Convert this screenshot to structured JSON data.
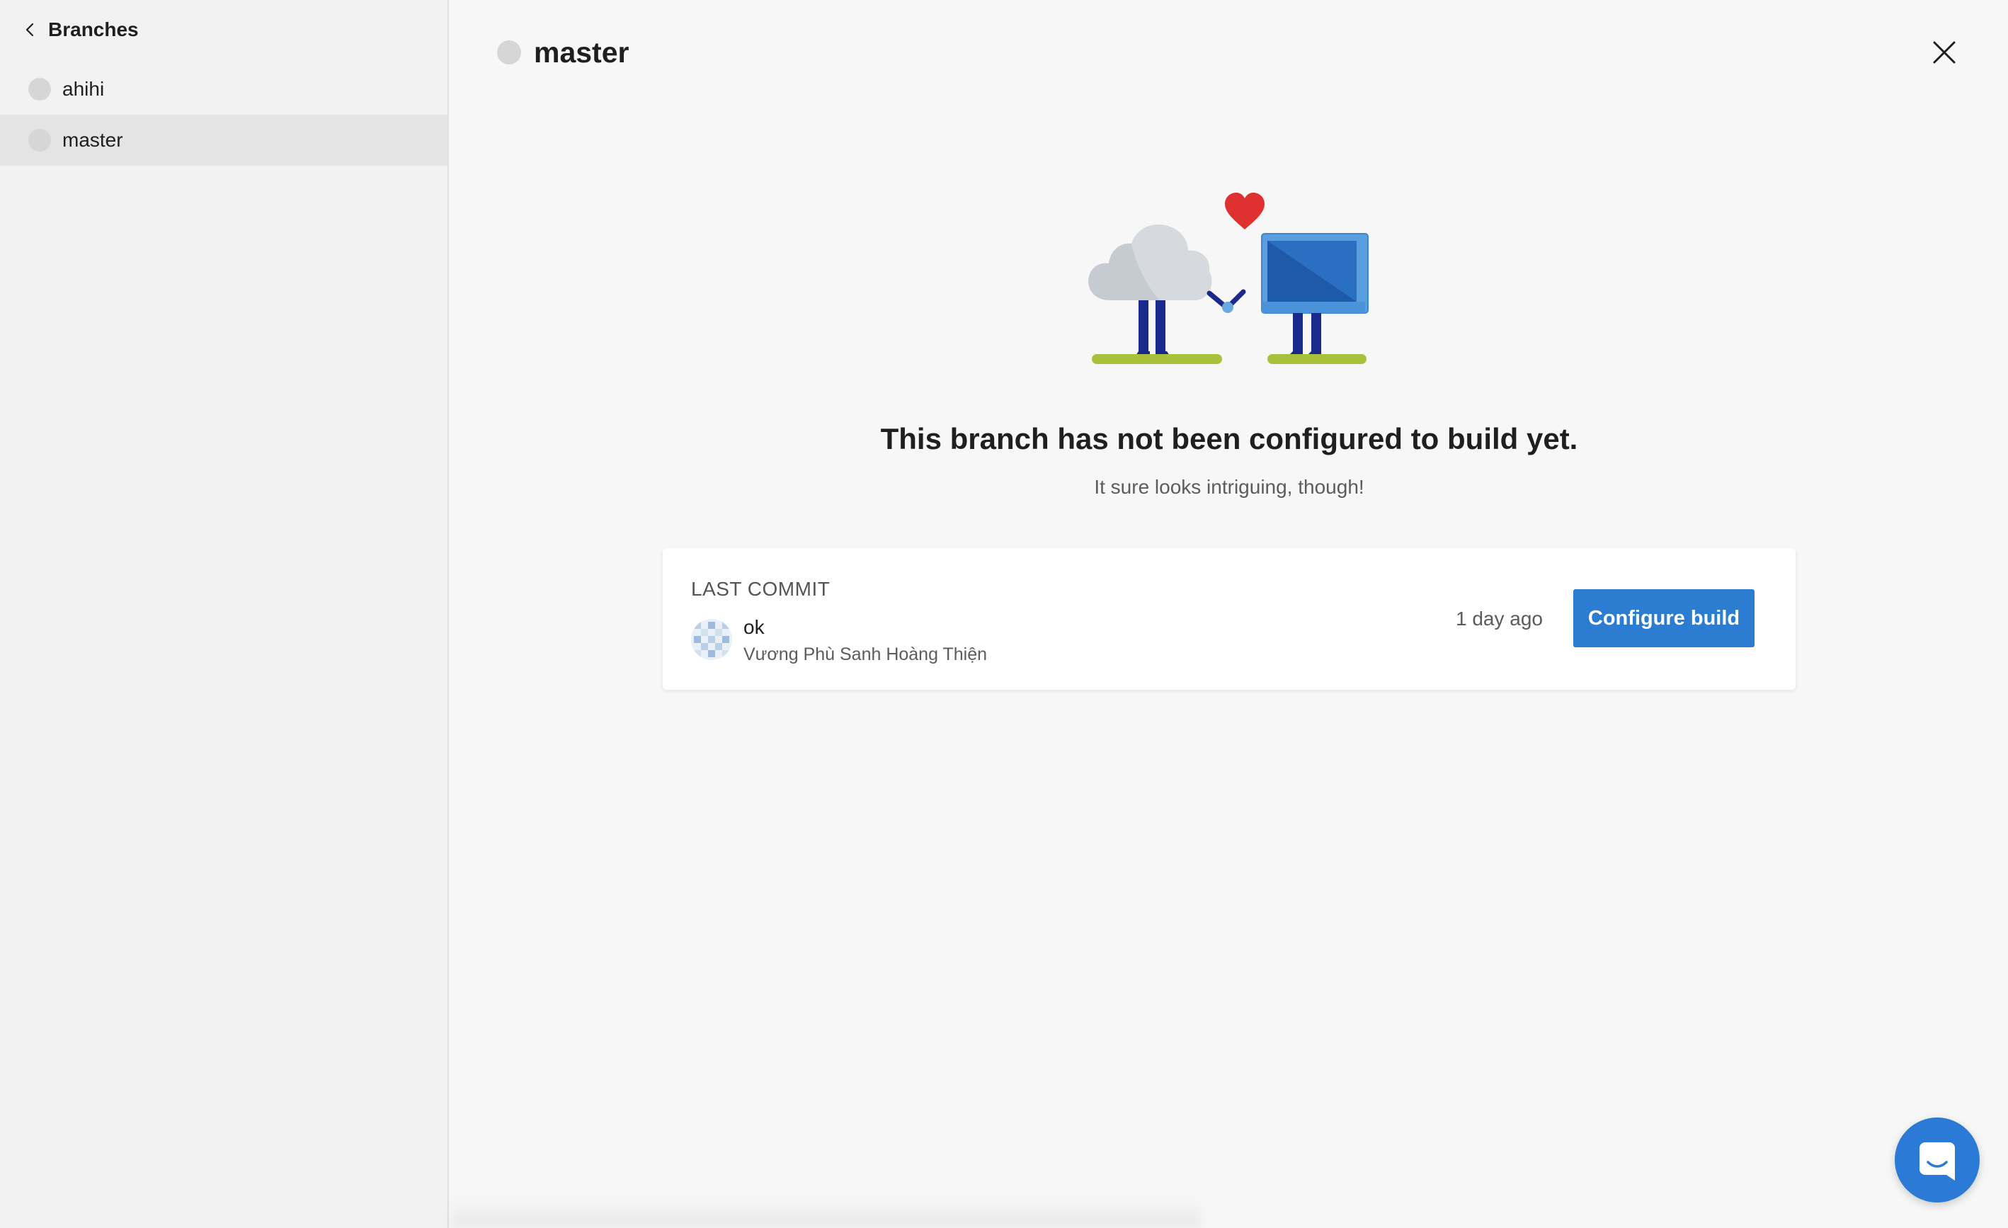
{
  "sidebar": {
    "back_label": "Branches",
    "branches": [
      {
        "name": "ahihi",
        "selected": false
      },
      {
        "name": "master",
        "selected": true
      }
    ]
  },
  "main": {
    "branch_title": "master",
    "empty_state": {
      "title": "This branch has not been configured to build yet.",
      "subtitle": "It sure looks intriguing, though!"
    },
    "last_commit": {
      "label": "LAST COMMIT",
      "message": "ok",
      "author": "Vương Phù Sanh Hoàng Thiện",
      "time": "1 day ago",
      "action_label": "Configure build"
    }
  },
  "colors": {
    "accent": "#2c7cd1",
    "status_dot": "#d6d6d6",
    "selected_row": "#e4e4e4",
    "heart": "#e03131"
  },
  "icons": [
    "chevron-left-icon",
    "close-icon",
    "chat-icon",
    "identicon-avatar",
    "cloud-loves-computer-illustration"
  ]
}
